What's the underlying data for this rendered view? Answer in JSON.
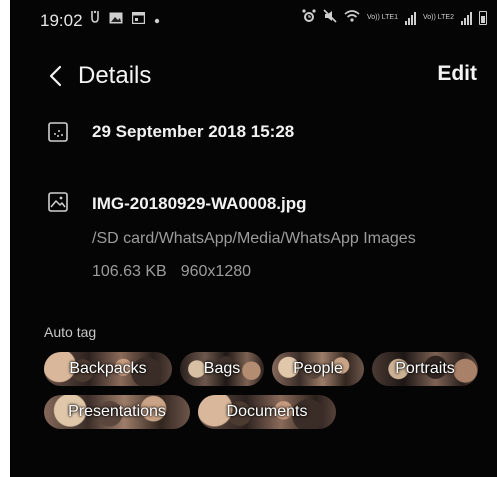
{
  "status_bar": {
    "time": "19:02",
    "left_icons": [
      "messenger-icon",
      "gallery-icon",
      "calendar-icon",
      "dot-icon"
    ],
    "right_icons": [
      "alarm-icon",
      "mute-icon",
      "wifi-icon",
      "volte1-icon",
      "signal1-icon",
      "volte2-icon",
      "signal2-icon",
      "battery-icon"
    ],
    "volte1_label": "Vo)) LTE1",
    "volte2_label": "Vo)) LTE2"
  },
  "header": {
    "title": "Details",
    "edit_label": "Edit"
  },
  "details": {
    "date": "29 September 2018 15:28",
    "file_name": "IMG-20180929-WA0008.jpg",
    "path": "/SD card/WhatsApp/Media/WhatsApp Images",
    "size": "106.63 KB",
    "resolution": "960x1280"
  },
  "auto_tag": {
    "label": "Auto tag",
    "tags": [
      "Backpacks",
      "Bags",
      "People",
      "Portraits",
      "Presentations",
      "Documents"
    ]
  },
  "colors": {
    "background": "#050505",
    "primary_text": "#f2f2f2",
    "secondary_text": "#9c9c9c"
  }
}
